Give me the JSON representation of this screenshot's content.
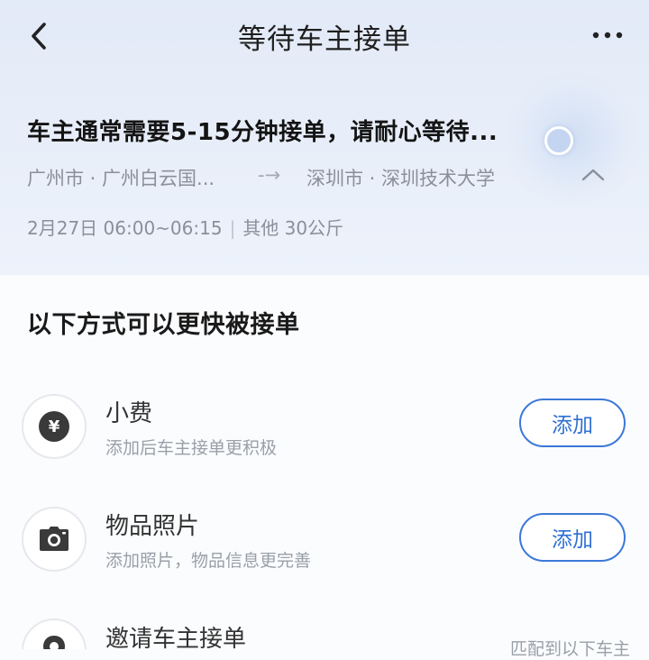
{
  "nav": {
    "title": "等待车主接单",
    "back_icon": "chevron-left-icon",
    "more_icon": "more-dots-icon"
  },
  "order": {
    "status": "车主通常需要5-15分钟接单，请耐心等待...",
    "from": "广州市 · 广州白云国...",
    "arrow": "-→",
    "to": "深圳市 · 深圳技术大学",
    "date_time": "2月27日 06:00~06:15",
    "separator": "|",
    "cargo": "其他 30公斤"
  },
  "section": {
    "title": "以下方式可以更快被接单"
  },
  "options": [
    {
      "title": "小费",
      "subtitle": "添加后车主接单更积极",
      "button": "添加",
      "icon": "yen-coin-icon"
    },
    {
      "title": "物品照片",
      "subtitle": "添加照片，物品信息更完善",
      "button": "添加",
      "icon": "camera-icon"
    },
    {
      "title": "邀请车主接单",
      "icon": "location-pin-icon"
    }
  ],
  "footer_partial": "匹配到以下车主",
  "colors": {
    "accent": "#2f6fd3",
    "header_bg": "#e6edf9",
    "muted_text": "#8a8f99"
  }
}
